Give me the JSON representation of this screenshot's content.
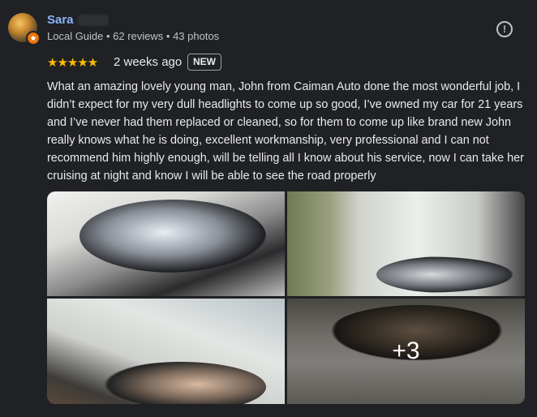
{
  "reviewer": {
    "name": "Sara",
    "meta": "Local Guide • 62 reviews • 43 photos",
    "avatar_badge_icon": "star-badge-icon"
  },
  "rating": {
    "stars": 5,
    "stars_text": "★★★★★",
    "date": "2 weeks ago",
    "badge": "NEW"
  },
  "review": {
    "text": "What an amazing lovely young man, John from Caiman Auto done the most wonderful job, I didn’t expect for my very dull headlights to come up so good, I’ve owned my car for 21 years and I’ve never had them replaced or cleaned, so for them to come up like brand new John really knows what he is doing, excellent workmanship, very professional and I can not recommend him highly enough, will be telling all I know about his service, now I can take her cruising at night and know I will be able to see the road properly"
  },
  "actions": {
    "info_icon": "report-icon",
    "info_glyph": "!"
  },
  "photos": {
    "more_label": "+3"
  },
  "colors": {
    "accent_name": "#8ab4f8",
    "star": "#fbbc04",
    "background": "#202124"
  }
}
